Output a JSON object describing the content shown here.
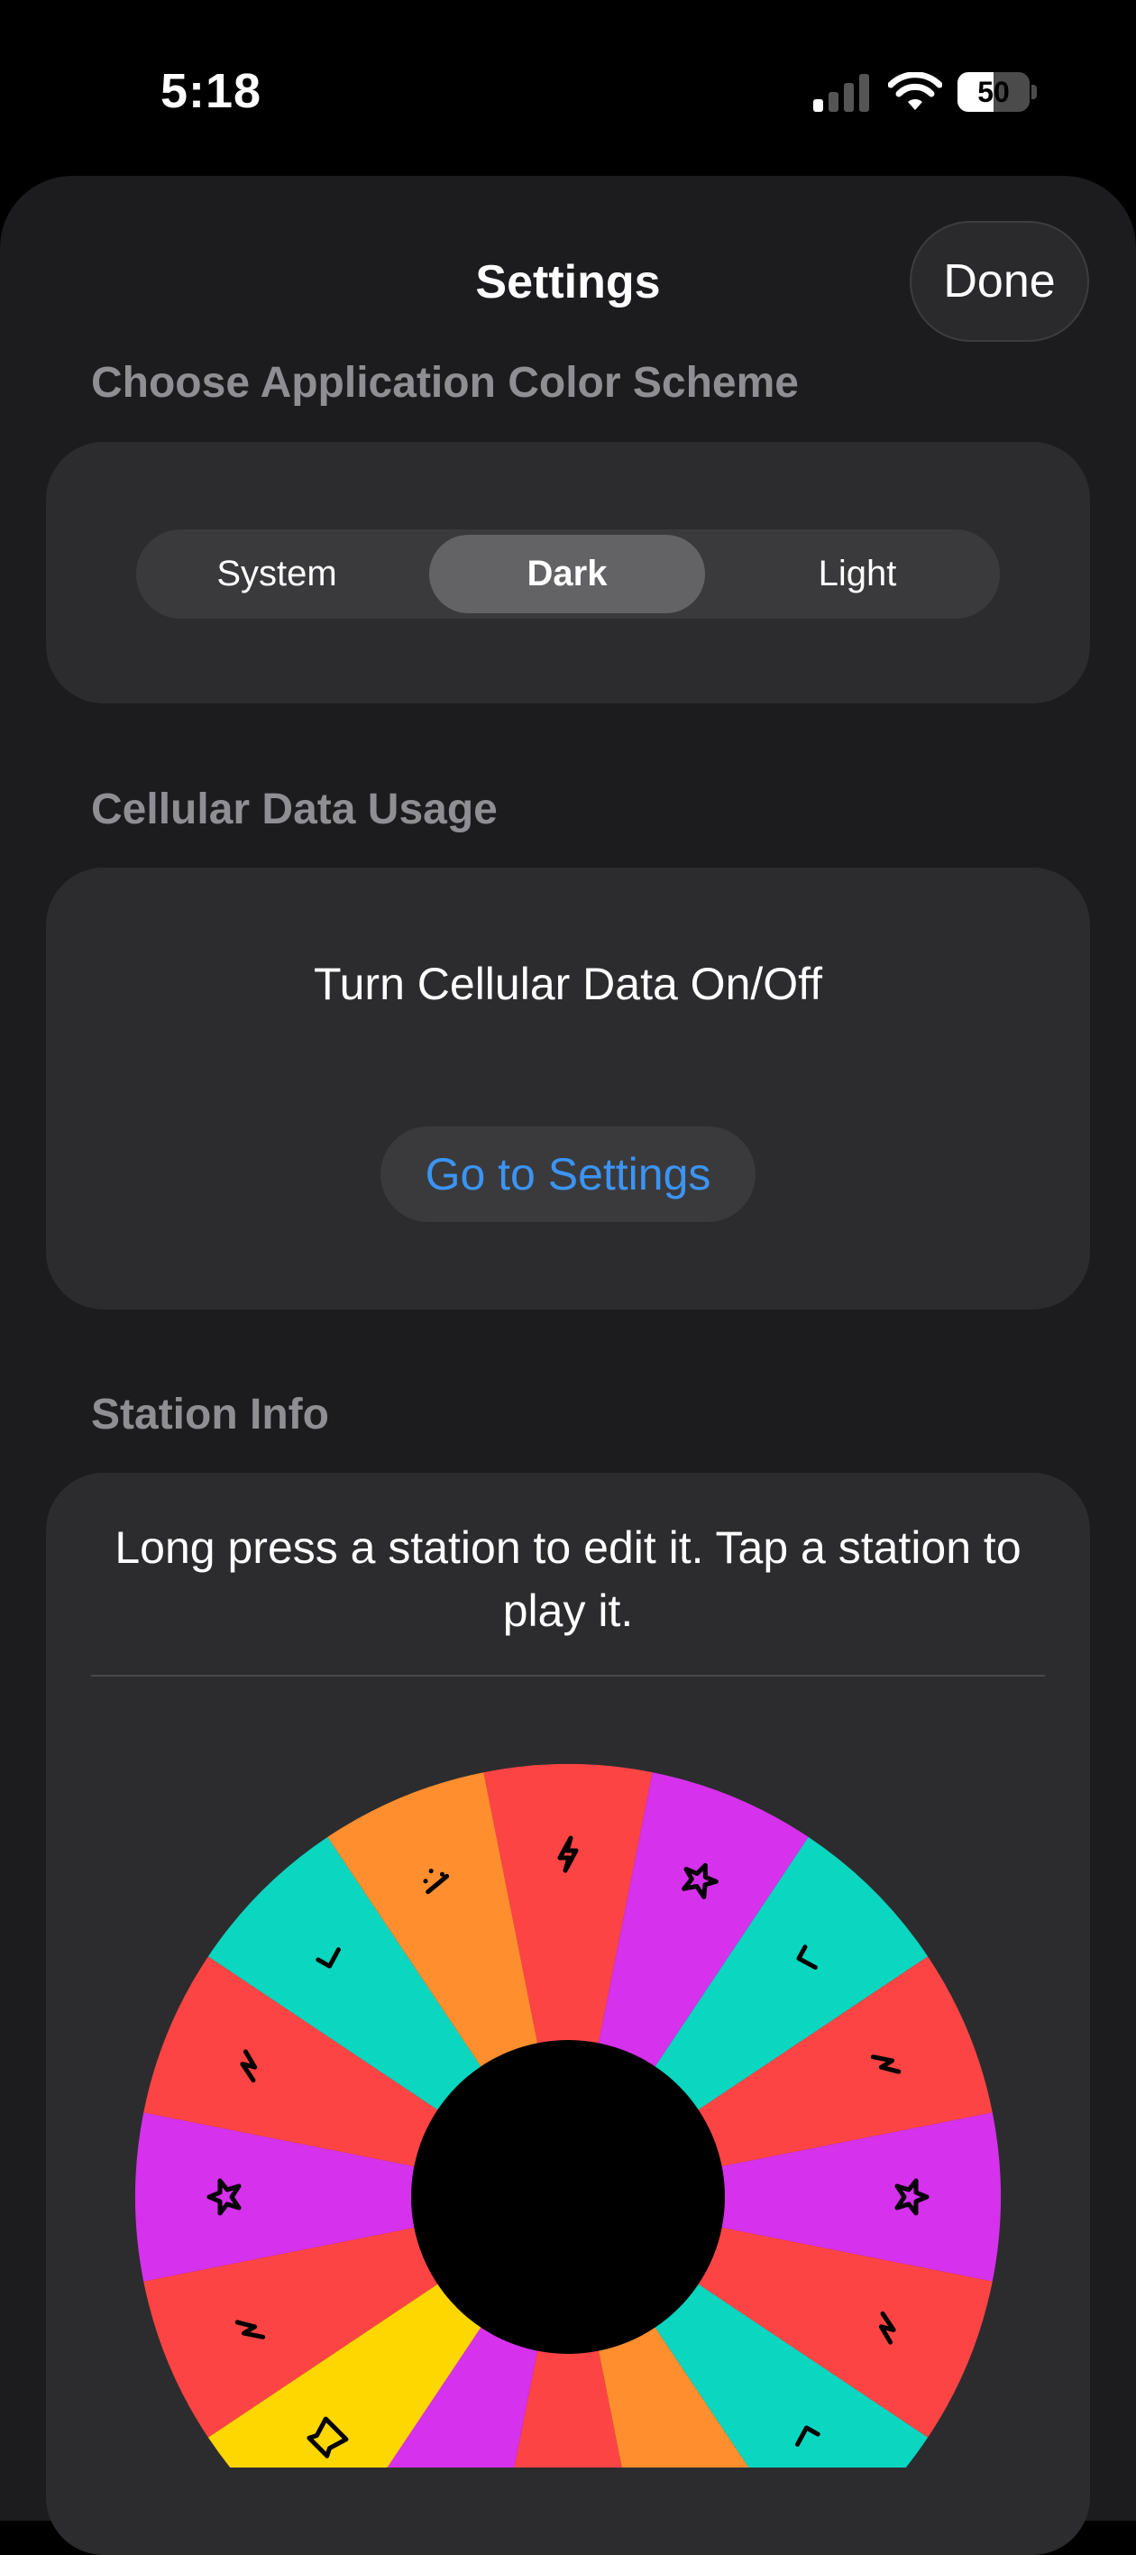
{
  "status_bar": {
    "time": "5:18",
    "battery_percent": 50,
    "signal_bars_active": 1,
    "signal_bars_total": 4
  },
  "nav": {
    "title": "Settings",
    "done_label": "Done"
  },
  "color_scheme": {
    "header": "Choose Application Color Scheme",
    "options": [
      "System",
      "Dark",
      "Light"
    ],
    "selected": "Dark"
  },
  "cellular": {
    "header": "Cellular Data Usage",
    "description": "Turn Cellular Data On/Off",
    "button_label": "Go to Settings"
  },
  "station_info": {
    "header": "Station Info",
    "description": "Long press a station to edit it. Tap a station to play it."
  },
  "colors": {
    "red": "#fd4444",
    "orange": "#fe8e2e",
    "magenta": "#d631ec",
    "teal": "#0bd6c0",
    "yellow": "#fed600",
    "accent_blue": "#3b94f5",
    "sheet_background": "#1c1c1e",
    "card_background": "#2c2c2e"
  },
  "station_wheel": {
    "segments": [
      {
        "color": "red",
        "icon": "lightning-bolt-icon"
      },
      {
        "color": "magenta",
        "icon": "star-icon"
      },
      {
        "color": "teal",
        "icon": "check-mark-icon"
      },
      {
        "color": "red",
        "icon": "zigzag-bolt-icon"
      },
      {
        "color": "magenta",
        "icon": "star-icon"
      },
      {
        "color": "red",
        "icon": "zigzag-bolt-icon"
      },
      {
        "color": "teal",
        "icon": "check-mark-icon"
      },
      {
        "color": "orange",
        "icon": ""
      },
      {
        "color": "red",
        "icon": ""
      },
      {
        "color": "magenta",
        "icon": ""
      },
      {
        "color": "yellow",
        "icon": "money-bag-icon"
      },
      {
        "color": "red",
        "icon": "zigzag-bolt-icon"
      },
      {
        "color": "magenta",
        "icon": "star-icon"
      },
      {
        "color": "red",
        "icon": "zigzag-bolt-icon"
      },
      {
        "color": "teal",
        "icon": "check-mark-icon"
      },
      {
        "color": "orange",
        "icon": "dots-icon"
      }
    ]
  }
}
